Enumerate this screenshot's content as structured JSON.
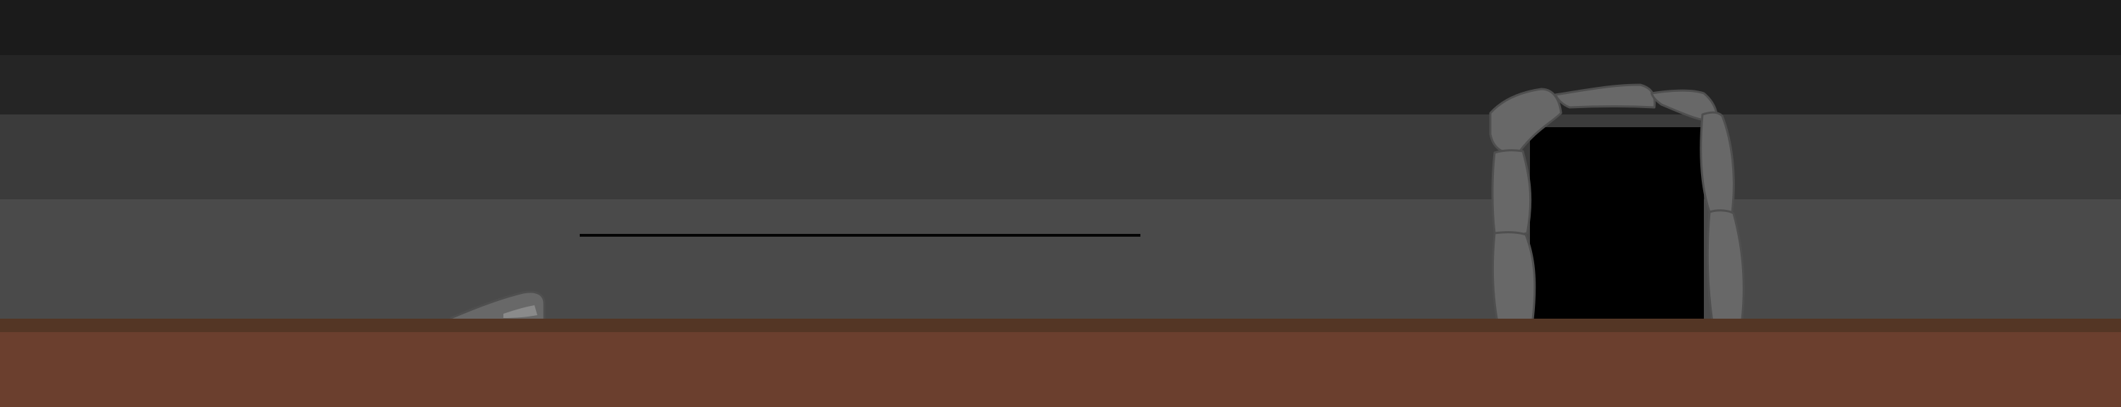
{
  "scene": {
    "colors": {
      "band_1": "#1b1b1b",
      "band_2": "#252525",
      "band_3": "#3b3b3b",
      "band_4": "#4a4a4a",
      "ground_edge": "#543625",
      "ground": "#6b3f2e",
      "rail": "#050505",
      "stone_fill": "#686868",
      "stone_stroke": "#4f4f4f",
      "stone_highlight": "#8a8a8a",
      "cave_interior": "#000000"
    },
    "elements": {
      "platform": "thin-rail-platform",
      "rock": "small-rock",
      "exit": "stone-arch-cave-entrance"
    }
  }
}
